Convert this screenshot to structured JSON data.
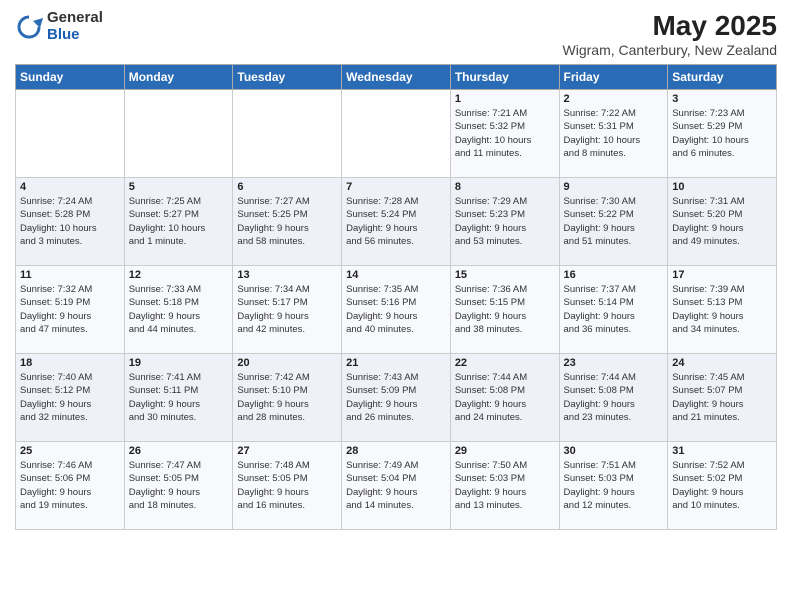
{
  "logo": {
    "general": "General",
    "blue": "Blue"
  },
  "title": {
    "month": "May 2025",
    "location": "Wigram, Canterbury, New Zealand"
  },
  "weekdays": [
    "Sunday",
    "Monday",
    "Tuesday",
    "Wednesday",
    "Thursday",
    "Friday",
    "Saturday"
  ],
  "weeks": [
    [
      {
        "day": "",
        "info": ""
      },
      {
        "day": "",
        "info": ""
      },
      {
        "day": "",
        "info": ""
      },
      {
        "day": "",
        "info": ""
      },
      {
        "day": "1",
        "info": "Sunrise: 7:21 AM\nSunset: 5:32 PM\nDaylight: 10 hours\nand 11 minutes."
      },
      {
        "day": "2",
        "info": "Sunrise: 7:22 AM\nSunset: 5:31 PM\nDaylight: 10 hours\nand 8 minutes."
      },
      {
        "day": "3",
        "info": "Sunrise: 7:23 AM\nSunset: 5:29 PM\nDaylight: 10 hours\nand 6 minutes."
      }
    ],
    [
      {
        "day": "4",
        "info": "Sunrise: 7:24 AM\nSunset: 5:28 PM\nDaylight: 10 hours\nand 3 minutes."
      },
      {
        "day": "5",
        "info": "Sunrise: 7:25 AM\nSunset: 5:27 PM\nDaylight: 10 hours\nand 1 minute."
      },
      {
        "day": "6",
        "info": "Sunrise: 7:27 AM\nSunset: 5:25 PM\nDaylight: 9 hours\nand 58 minutes."
      },
      {
        "day": "7",
        "info": "Sunrise: 7:28 AM\nSunset: 5:24 PM\nDaylight: 9 hours\nand 56 minutes."
      },
      {
        "day": "8",
        "info": "Sunrise: 7:29 AM\nSunset: 5:23 PM\nDaylight: 9 hours\nand 53 minutes."
      },
      {
        "day": "9",
        "info": "Sunrise: 7:30 AM\nSunset: 5:22 PM\nDaylight: 9 hours\nand 51 minutes."
      },
      {
        "day": "10",
        "info": "Sunrise: 7:31 AM\nSunset: 5:20 PM\nDaylight: 9 hours\nand 49 minutes."
      }
    ],
    [
      {
        "day": "11",
        "info": "Sunrise: 7:32 AM\nSunset: 5:19 PM\nDaylight: 9 hours\nand 47 minutes."
      },
      {
        "day": "12",
        "info": "Sunrise: 7:33 AM\nSunset: 5:18 PM\nDaylight: 9 hours\nand 44 minutes."
      },
      {
        "day": "13",
        "info": "Sunrise: 7:34 AM\nSunset: 5:17 PM\nDaylight: 9 hours\nand 42 minutes."
      },
      {
        "day": "14",
        "info": "Sunrise: 7:35 AM\nSunset: 5:16 PM\nDaylight: 9 hours\nand 40 minutes."
      },
      {
        "day": "15",
        "info": "Sunrise: 7:36 AM\nSunset: 5:15 PM\nDaylight: 9 hours\nand 38 minutes."
      },
      {
        "day": "16",
        "info": "Sunrise: 7:37 AM\nSunset: 5:14 PM\nDaylight: 9 hours\nand 36 minutes."
      },
      {
        "day": "17",
        "info": "Sunrise: 7:39 AM\nSunset: 5:13 PM\nDaylight: 9 hours\nand 34 minutes."
      }
    ],
    [
      {
        "day": "18",
        "info": "Sunrise: 7:40 AM\nSunset: 5:12 PM\nDaylight: 9 hours\nand 32 minutes."
      },
      {
        "day": "19",
        "info": "Sunrise: 7:41 AM\nSunset: 5:11 PM\nDaylight: 9 hours\nand 30 minutes."
      },
      {
        "day": "20",
        "info": "Sunrise: 7:42 AM\nSunset: 5:10 PM\nDaylight: 9 hours\nand 28 minutes."
      },
      {
        "day": "21",
        "info": "Sunrise: 7:43 AM\nSunset: 5:09 PM\nDaylight: 9 hours\nand 26 minutes."
      },
      {
        "day": "22",
        "info": "Sunrise: 7:44 AM\nSunset: 5:08 PM\nDaylight: 9 hours\nand 24 minutes."
      },
      {
        "day": "23",
        "info": "Sunrise: 7:44 AM\nSunset: 5:08 PM\nDaylight: 9 hours\nand 23 minutes."
      },
      {
        "day": "24",
        "info": "Sunrise: 7:45 AM\nSunset: 5:07 PM\nDaylight: 9 hours\nand 21 minutes."
      }
    ],
    [
      {
        "day": "25",
        "info": "Sunrise: 7:46 AM\nSunset: 5:06 PM\nDaylight: 9 hours\nand 19 minutes."
      },
      {
        "day": "26",
        "info": "Sunrise: 7:47 AM\nSunset: 5:05 PM\nDaylight: 9 hours\nand 18 minutes."
      },
      {
        "day": "27",
        "info": "Sunrise: 7:48 AM\nSunset: 5:05 PM\nDaylight: 9 hours\nand 16 minutes."
      },
      {
        "day": "28",
        "info": "Sunrise: 7:49 AM\nSunset: 5:04 PM\nDaylight: 9 hours\nand 14 minutes."
      },
      {
        "day": "29",
        "info": "Sunrise: 7:50 AM\nSunset: 5:03 PM\nDaylight: 9 hours\nand 13 minutes."
      },
      {
        "day": "30",
        "info": "Sunrise: 7:51 AM\nSunset: 5:03 PM\nDaylight: 9 hours\nand 12 minutes."
      },
      {
        "day": "31",
        "info": "Sunrise: 7:52 AM\nSunset: 5:02 PM\nDaylight: 9 hours\nand 10 minutes."
      }
    ]
  ]
}
